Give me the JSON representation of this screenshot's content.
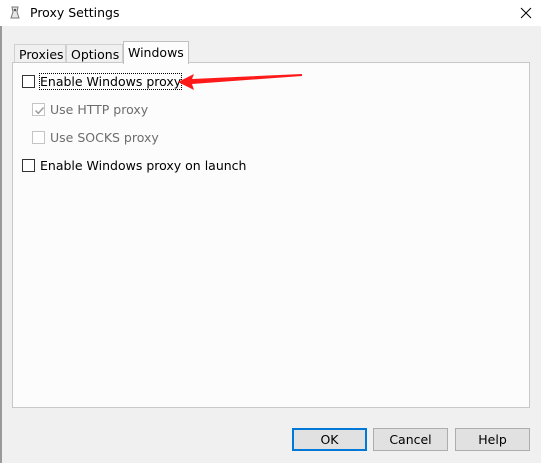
{
  "window": {
    "title": "Proxy Settings",
    "icon": "app-icon",
    "close_icon": "close-icon"
  },
  "tabs": [
    {
      "label": "Proxies",
      "active": false
    },
    {
      "label": "Options",
      "active": false
    },
    {
      "label": "Windows",
      "active": true
    }
  ],
  "options": {
    "enable_windows_proxy": {
      "label": "Enable Windows proxy",
      "checked": false,
      "enabled": true
    },
    "use_http_proxy": {
      "label": "Use HTTP proxy",
      "checked": true,
      "enabled": false
    },
    "use_socks_proxy": {
      "label": "Use SOCKS proxy",
      "checked": false,
      "enabled": false
    },
    "enable_on_launch": {
      "label": "Enable Windows proxy on launch",
      "checked": false,
      "enabled": true
    }
  },
  "annotation": {
    "color": "#ff1a1a",
    "points_to": "Enable Windows proxy"
  },
  "buttons": {
    "ok": "OK",
    "cancel": "Cancel",
    "help": "Help"
  },
  "colors": {
    "accent": "#0078d7"
  }
}
